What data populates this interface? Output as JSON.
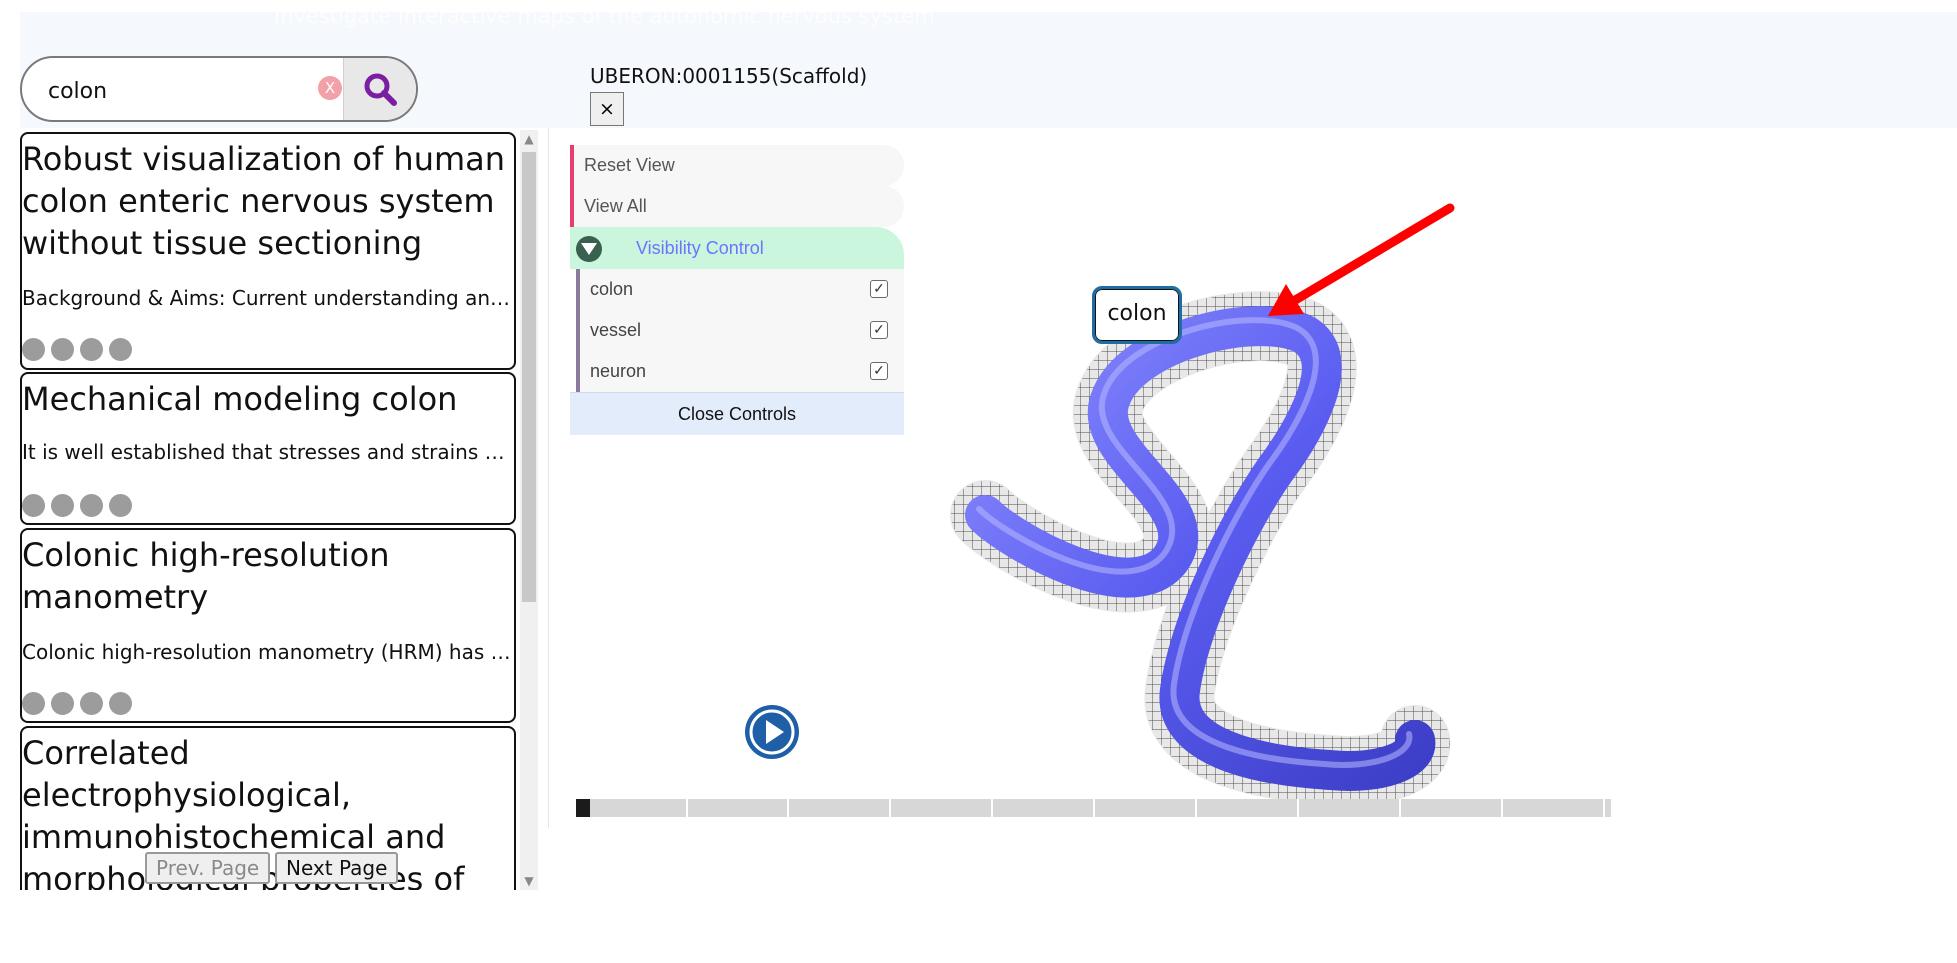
{
  "header": {
    "faded_text": "Investigate interactive maps of the autonomic nervous system"
  },
  "search": {
    "query": "colon",
    "clear_glyph": "X",
    "search_icon": "magnifier-icon"
  },
  "results": [
    {
      "title": "Robust visualization of human colon enteric nervous system without tissue sectioning",
      "abstract": "Background & Aims: Current understanding and m...",
      "dots": 4
    },
    {
      "title": "Mechanical modeling colon",
      "abstract": "It is well established that stresses and strains are...",
      "dots": 4
    },
    {
      "title": "Colonic high-resolution manometry",
      "abstract": "Colonic high-resolution manometry (HRM) has be...",
      "dots": 4
    },
    {
      "title": "Correlated electrophysiological, immunohistochemical and morphological properties of proxima",
      "abstract": "",
      "dots": 0
    }
  ],
  "pagination": {
    "prev_label": "Prev. Page",
    "next_label": "Next Page"
  },
  "viewer": {
    "title": "UBERON:0001155(Scaffold)",
    "close_glyph": "×",
    "tooltip_label": "colon",
    "arrow_color": "#ff0000",
    "tube_color": "#5a5cf0",
    "mesh_color": "#4a4a4a"
  },
  "controls": {
    "reset_view": "Reset View",
    "view_all": "View All",
    "folder_label": "Visibility Control",
    "items": [
      {
        "label": "colon",
        "checked": true
      },
      {
        "label": "vessel",
        "checked": true
      },
      {
        "label": "neuron",
        "checked": true
      }
    ],
    "close_label": "Close Controls",
    "check_glyph": "✓"
  },
  "timeline": {
    "position": 0,
    "ticks": 10
  }
}
